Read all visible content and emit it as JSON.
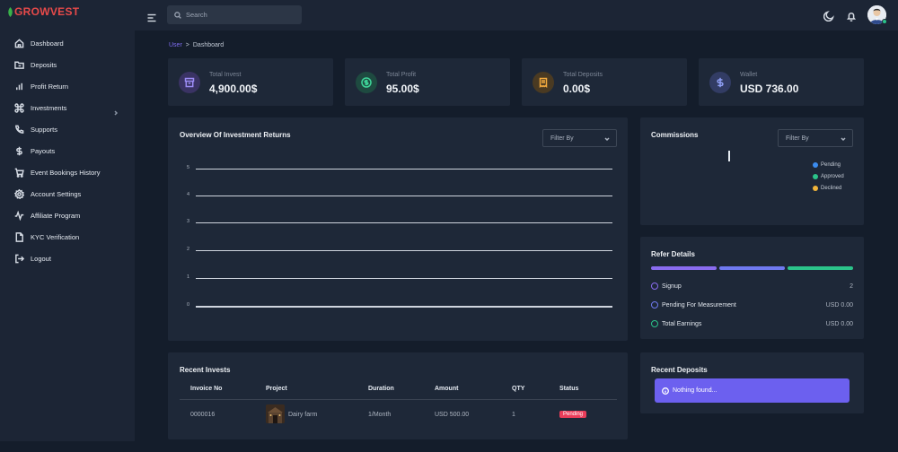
{
  "brand": {
    "name": "GROWVEST"
  },
  "sidebar": {
    "items": [
      {
        "label": "Dashboard",
        "icon": "home-icon"
      },
      {
        "label": "Deposits",
        "icon": "folder-icon"
      },
      {
        "label": "Profit Return",
        "icon": "bar-chart-icon"
      },
      {
        "label": "Investments",
        "icon": "command-icon",
        "has_submenu": true
      },
      {
        "label": "Supports",
        "icon": "phone-icon"
      },
      {
        "label": "Payouts",
        "icon": "dollar-icon"
      },
      {
        "label": "Event Bookings History",
        "icon": "cart-icon"
      },
      {
        "label": "Account Settings",
        "icon": "gear-icon"
      },
      {
        "label": "Affiliate Program",
        "icon": "activity-icon"
      },
      {
        "label": "KYC Verification",
        "icon": "file-icon"
      },
      {
        "label": "Logout",
        "icon": "logout-icon"
      }
    ]
  },
  "topbar": {
    "search_placeholder": "Search"
  },
  "breadcrumb": {
    "root": "User",
    "separator": ">",
    "current": "Dashboard"
  },
  "stats": [
    {
      "label": "Total Invest",
      "value": "4,900.00$",
      "icon": "archive-icon",
      "color": "#7c6cf0"
    },
    {
      "label": "Total Profit",
      "value": "95.00$",
      "icon": "dollar-circle-icon",
      "color": "#2bc48a"
    },
    {
      "label": "Total Deposits",
      "value": "0.00$",
      "icon": "receipt-icon",
      "color": "#f0a63a"
    },
    {
      "label": "Wallet",
      "value": "USD 736.00",
      "icon": "dollar-icon",
      "color": "#7a8cf0"
    }
  ],
  "overview": {
    "title": "Overview Of Investment Returns",
    "filter_label": "Filter By",
    "y_ticks": [
      "5",
      "4",
      "3",
      "2",
      "1",
      "0"
    ]
  },
  "chart_data": {
    "type": "line",
    "title": "Overview Of Investment Returns",
    "xlabel": "",
    "ylabel": "",
    "ylim": [
      0,
      5
    ],
    "y_ticks": [
      0,
      1,
      2,
      3,
      4,
      5
    ],
    "grid": true,
    "series": []
  },
  "commissions": {
    "title": "Commissions",
    "filter_label": "Filter By",
    "legend": [
      {
        "label": "Pending",
        "color": "#3b8cf0"
      },
      {
        "label": "Approved",
        "color": "#2bc48a"
      },
      {
        "label": "Declined",
        "color": "#f0b43a"
      }
    ]
  },
  "refer": {
    "title": "Refer Details",
    "bar_colors": [
      "#8a6cf0",
      "#6f79f0",
      "#2bc48a"
    ],
    "rows": [
      {
        "label": "Signup",
        "value": "2",
        "color": "#8a6cf0"
      },
      {
        "label": "Pending For Measurement",
        "value": "USD 0.00",
        "color": "#6f79f0"
      },
      {
        "label": "Total Earnings",
        "value": "USD 0.00",
        "color": "#2bc48a"
      }
    ]
  },
  "recent_invests": {
    "title": "Recent Invests",
    "columns": [
      "Invoice No",
      "Project",
      "Duration",
      "Amount",
      "QTY",
      "Status"
    ],
    "rows": [
      {
        "invoice": "0000016",
        "project": "Dairy farm",
        "duration": "1/Month",
        "amount": "USD 500.00",
        "qty": "1",
        "status": "Pending"
      }
    ]
  },
  "recent_deposits": {
    "title": "Recent Deposits",
    "empty_message": "Nothing found..."
  }
}
